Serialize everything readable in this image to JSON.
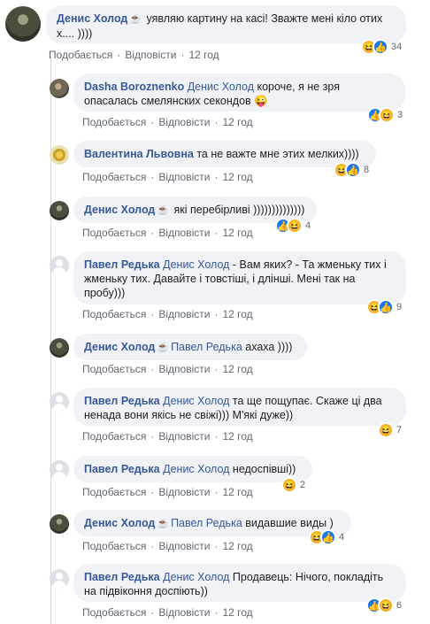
{
  "ui": {
    "like": "Подобається",
    "reply": "Відповісти",
    "sep": "·",
    "cup": "☕"
  },
  "comments": [
    {
      "author": "Денис Холод",
      "text_l1": " уявляю картину на касі! Зважте мені кіло отих",
      "text_l2": "х.... ))))",
      "time": "12 год",
      "count": "34",
      "reactions": [
        "haha",
        "like"
      ]
    },
    {
      "author": "Dasha Boroznenko",
      "mention": "Денис Холод",
      "text_l1": " короче, я не зря",
      "text_l2": "опасалась смелянских секондов 😜",
      "time": "12 год",
      "count": "3",
      "reactions": [
        "like",
        "haha"
      ]
    },
    {
      "author": "Валентина Львовна",
      "text": " та не важте мне этих мелких))))",
      "time": "12 год",
      "count": "8",
      "reactions": [
        "haha",
        "like"
      ]
    },
    {
      "author": "Денис Холод",
      "text": " які перебірливі ))))))))))))))",
      "time": "12 год",
      "count": "4",
      "reactions": [
        "like",
        "haha"
      ]
    },
    {
      "author": "Павел Редька",
      "mention": "Денис Холод",
      "text_l1": " - Вам яких? - Та жменьку тих і",
      "text_l2": "жменьку тих. Давайте і товстіші, і длінші. Мені так на",
      "text_l3": "пробу)))",
      "time": "12 год",
      "count": "9",
      "reactions": [
        "haha",
        "like"
      ]
    },
    {
      "author": "Денис Холод",
      "mention": "Павел Редька",
      "text": " ахаха ))))",
      "time": "12 год"
    },
    {
      "author": "Павел Редька",
      "mention": "Денис Холод",
      "text_l1": " та ще пощупає. Скаже ці два",
      "text_l2": "ненада вони якісь не свіжі))) М'які дуже))",
      "time": "12 год",
      "count": "7",
      "reactions": [
        "haha"
      ]
    },
    {
      "author": "Павел Редька",
      "mention": "Денис Холод",
      "text": " недоспівші))",
      "time": "12 год",
      "count": "2",
      "reactions": [
        "haha"
      ]
    },
    {
      "author": "Денис Холод",
      "mention": "Павел Редька",
      "text": " видавшие виды )",
      "time": "12 год",
      "count": "4",
      "reactions": [
        "haha",
        "like"
      ]
    },
    {
      "author": "Павел Редька",
      "mention": "Денис Холод",
      "text_l1": " Продавець: Нічого, покладіть",
      "text_l2": "на підвіконня доспіють))",
      "time": "12 год",
      "count": "6",
      "reactions": [
        "like",
        "haha"
      ]
    }
  ]
}
